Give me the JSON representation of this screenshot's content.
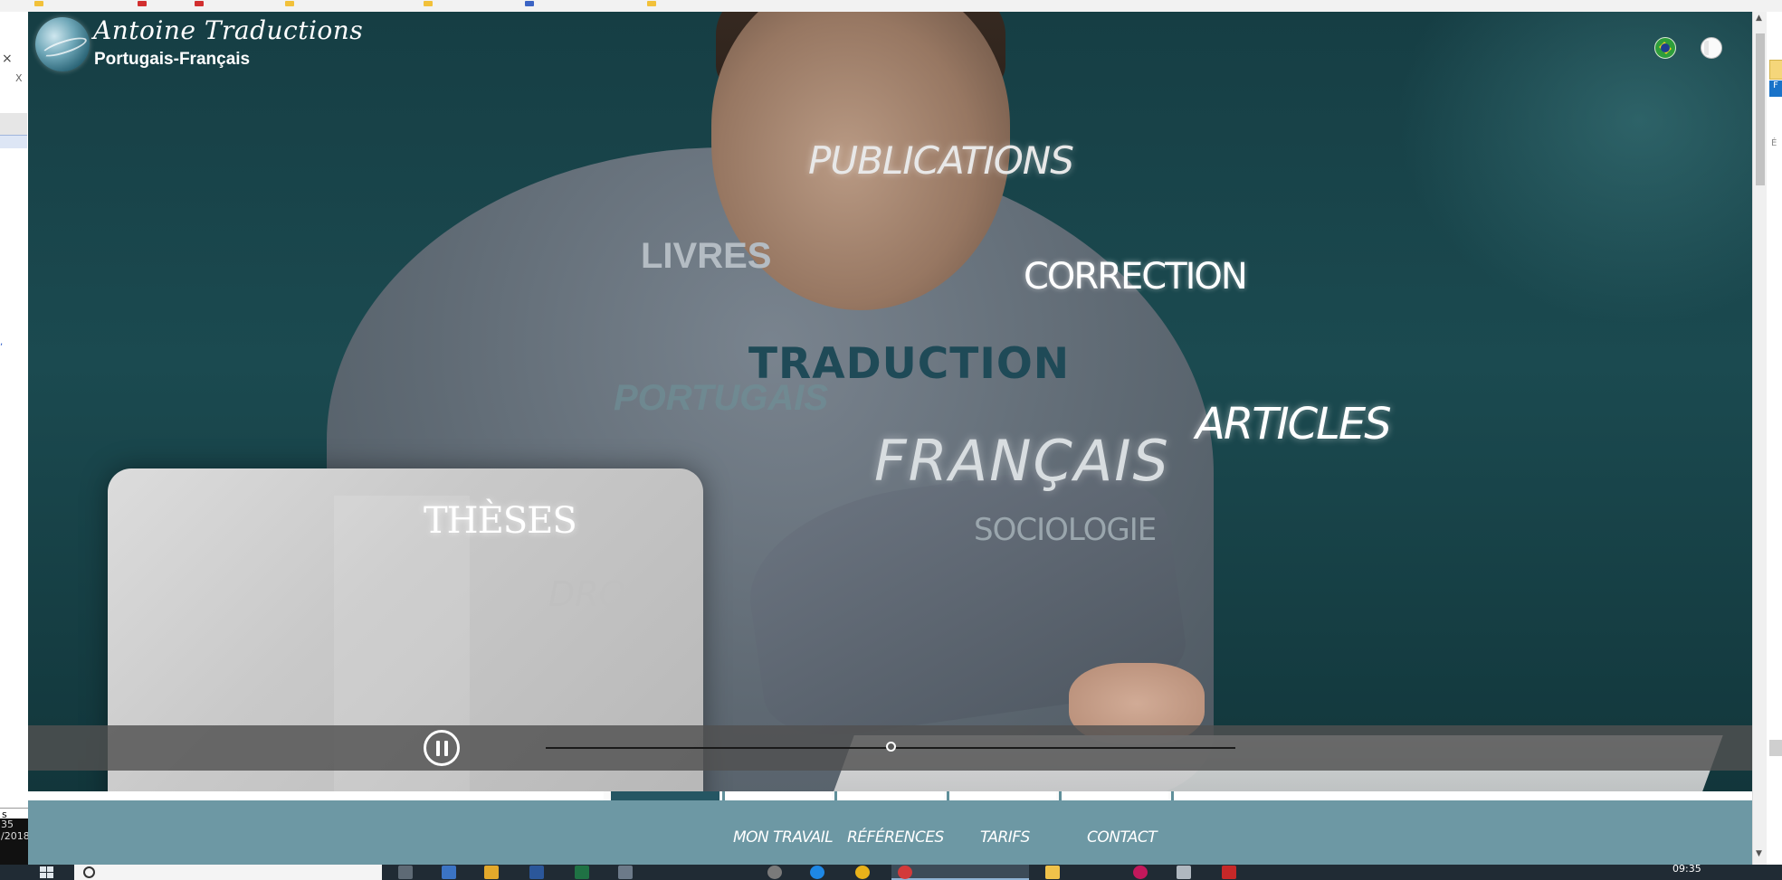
{
  "site": {
    "brand_title": "Antoine Traductions",
    "brand_subtitle": "Portugais-Français"
  },
  "hero_words": {
    "publications": "PUBLICATIONS",
    "livres": "LIVRES",
    "correction": "CORRECTION",
    "traduction": "TRADUCTION",
    "portugais": "PORTUGAIS",
    "articles": "ARTICLES",
    "francais": "FRANÇAIS",
    "theses": "THÈSES",
    "sociologie": "SOCIOLOGIE",
    "droit": "DROIT"
  },
  "video": {
    "state": "playing",
    "progress": 0.5
  },
  "nav": {
    "items": [
      {
        "label": "MON TRAVAIL"
      },
      {
        "label": "RÉFÉRENCES"
      },
      {
        "label": "TARIFS"
      },
      {
        "label": "CONTACT"
      }
    ]
  },
  "language_flags": [
    "brazil-flag-icon",
    "france-flag-icon"
  ],
  "colors": {
    "nav_bar": "#6d98a4",
    "nav_active": "#255663",
    "hero_background": "#1b4a50"
  },
  "left_window": {
    "close": "×",
    "small_x": "X",
    "taskbar_label": "s",
    "clock_line1": "35",
    "clock_line2": "/2018"
  },
  "right_window": {
    "button_label": "F",
    "text": "É"
  },
  "taskbar": {
    "clock": "09:35"
  }
}
